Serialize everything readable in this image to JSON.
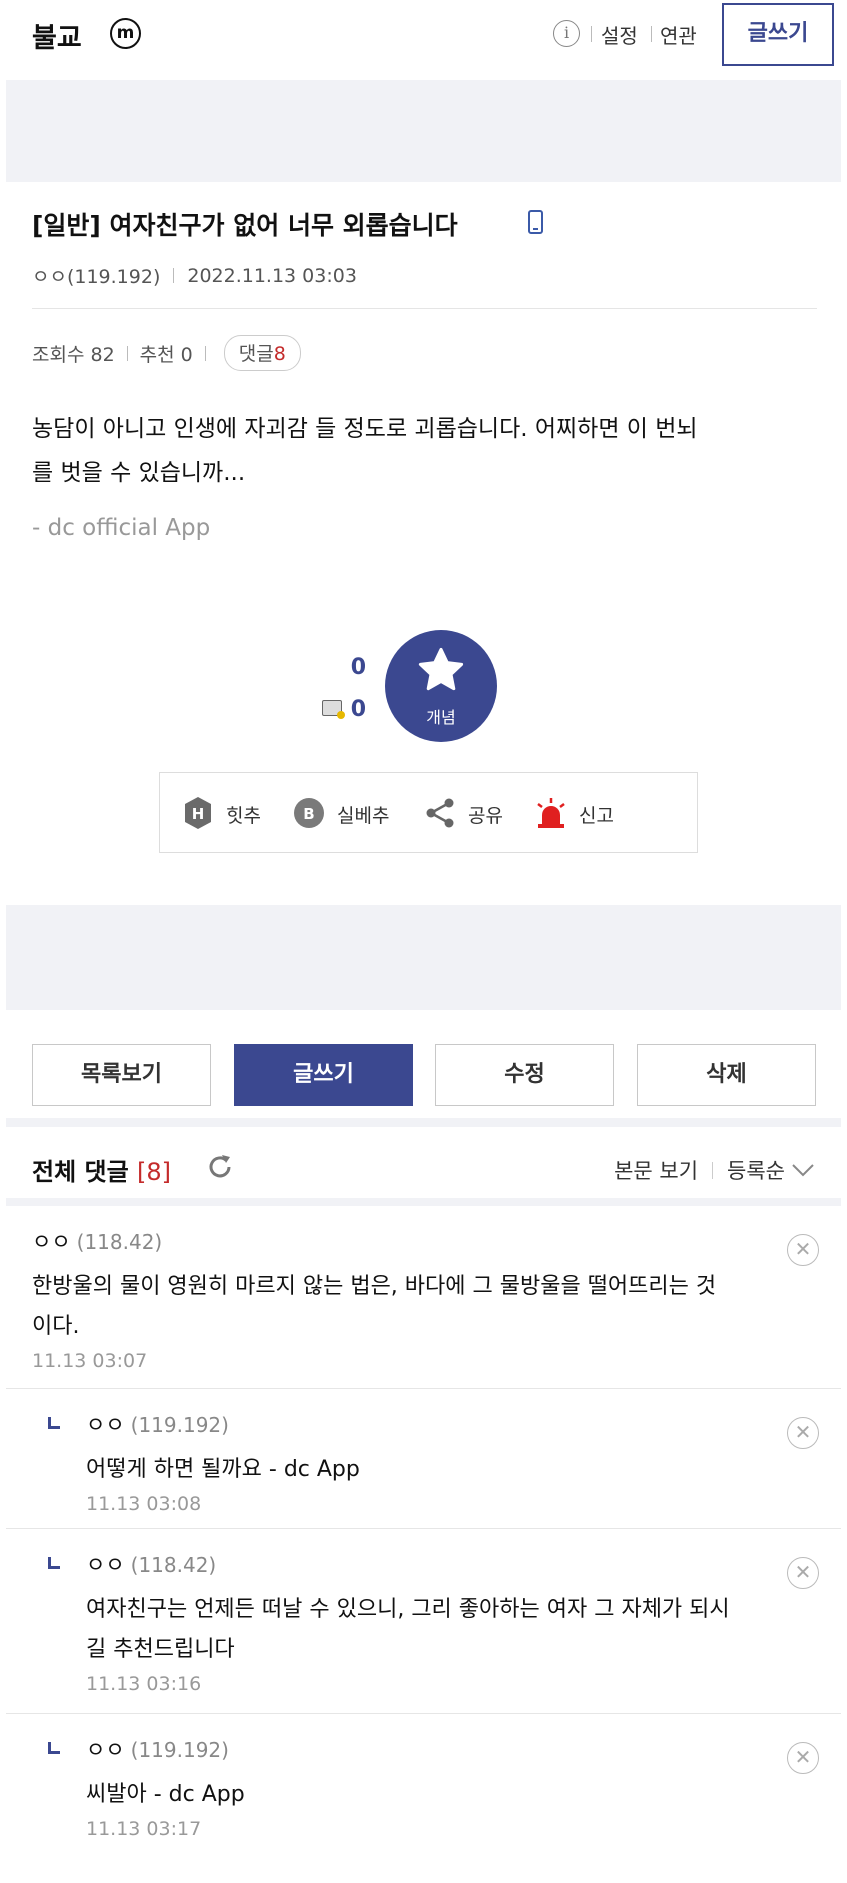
{
  "header": {
    "gallery_title": "불교",
    "mini_badge": "m",
    "info_icon": "i",
    "links": [
      "설정",
      "연관"
    ],
    "write_button": "글쓰기"
  },
  "post": {
    "title": "[일반] 여자친구가 없어 너무 외롭습니다",
    "author": "ㅇㅇ(119.192)",
    "date": "2022.11.13 03:03",
    "views_label": "조회수 82",
    "recommend_label": "추천 0",
    "reply_label": "댓글",
    "reply_count": "8",
    "body_line1": "농담이 아니고 인생에 자괴감 들 정도로 괴롭습니다. 어찌하면 이 번뇌",
    "body_line2": "를 벗을 수 있습니까...",
    "app_sign": "- dc official App"
  },
  "recommend": {
    "up_count": "0",
    "fixed_count": "0",
    "star_label": "개념"
  },
  "actions": {
    "hit": "힛추",
    "best": "실베추",
    "share": "공유",
    "report": "신고",
    "hit_glyph": "H",
    "best_glyph": "B"
  },
  "buttons": {
    "list": "목록보기",
    "write": "글쓰기",
    "edit": "수정",
    "delete": "삭제"
  },
  "comments_header": {
    "title": "전체 댓글",
    "count": "[8]",
    "view_body": "본문 보기",
    "sort": "등록순"
  },
  "comments": [
    {
      "name": "ㅇㅇ",
      "ip": "(118.42)",
      "line1": "한방울의 물이 영원히 마르지 않는 법은, 바다에 그 물방울을 떨어뜨리는 것",
      "line2": "이다.",
      "date": "11.13 03:07"
    },
    {
      "name": "ㅇㅇ",
      "ip": "(119.192)",
      "line1": "어떻게 하면 될까요 - dc App",
      "line2": "",
      "date": "11.13 03:08"
    },
    {
      "name": "ㅇㅇ",
      "ip": "(118.42)",
      "line1": "여자친구는 언제든 떠날 수 있으니, 그리 좋아하는 여자 그 자체가 되시",
      "line2": "길 추천드립니다",
      "date": "11.13 03:16"
    },
    {
      "name": "ㅇㅇ",
      "ip": "(119.192)",
      "line1": "씨발아 - dc App",
      "line2": "",
      "date": "11.13 03:17"
    }
  ],
  "delete_glyph": "✕",
  "colors": {
    "accent": "#3b4890",
    "count_red": "#c42b2b",
    "band_gray": "#f1f2f6"
  }
}
